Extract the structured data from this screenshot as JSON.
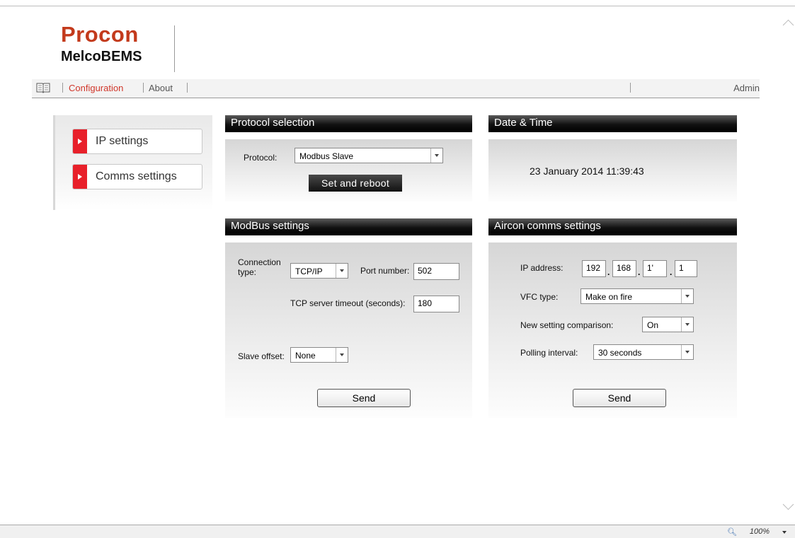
{
  "header": {
    "brand": "Procon",
    "product": "MelcoBEMS"
  },
  "nav": {
    "configuration": "Configuration",
    "about": "About",
    "user": "Admin"
  },
  "sidebar": {
    "items": [
      {
        "label": "IP settings"
      },
      {
        "label": "Comms settings"
      }
    ]
  },
  "protocol": {
    "title": "Protocol selection",
    "label": "Protocol:",
    "value": "Modbus Slave",
    "button": "Set and reboot"
  },
  "datetime": {
    "title": "Date & Time",
    "value": "23 January 2014 11:39:43"
  },
  "modbus": {
    "title": "ModBus settings",
    "connection_label": "Connection type:",
    "connection_value": "TCP/IP",
    "port_label": "Port number:",
    "port_value": "502",
    "timeout_label": "TCP server timeout (seconds):",
    "timeout_value": "180",
    "slave_offset_label": "Slave offset:",
    "slave_offset_value": "None",
    "send": "Send"
  },
  "aircon": {
    "title": "Aircon comms settings",
    "ip_label": "IP address:",
    "ip_octets": [
      "192",
      "168",
      "1'",
      "1"
    ],
    "vfc_label": "VFC type:",
    "vfc_value": "Make on fire",
    "comparison_label": "New setting comparison:",
    "comparison_value": "On",
    "polling_label": "Polling interval:",
    "polling_value": "30 seconds",
    "send": "Send"
  },
  "statusbar": {
    "zoom": "100%"
  },
  "colors": {
    "brand": "#c33a1c",
    "nav_active": "#d0362a",
    "sidebar_marker": "#e8202a",
    "header_bar": "#000000"
  }
}
